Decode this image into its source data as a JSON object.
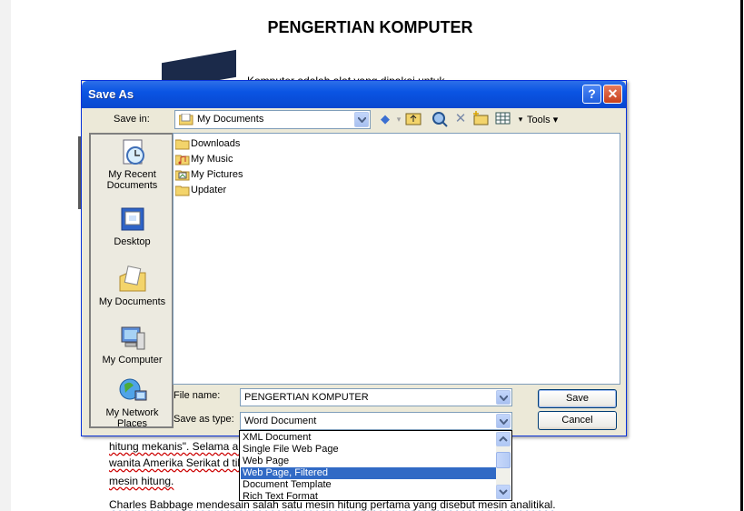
{
  "document": {
    "title": "PENGERTIAN KOMPUTER",
    "partial_line_top": "Komputer adalah alat yang dipakai untuk",
    "line1": "hitung mekanis\". Selama                                                                    ara pekerja",
    "line2": "wanita Amerika Serikat d                                                                  tileri perang dengan",
    "line3": "mesin hitung.",
    "line4": "Charles Babbage mendesain salah satu mesin hitung pertama yang disebut mesin analitikal."
  },
  "dialog": {
    "title": "Save As",
    "help_label": "?",
    "close_label": "✕",
    "save_in_label": "Save in:",
    "save_in_value": "My Documents",
    "tools_label": "Tools",
    "places": [
      {
        "label": "My Recent Documents",
        "icon": "recent-documents-icon"
      },
      {
        "label": "Desktop",
        "icon": "desktop-icon"
      },
      {
        "label": "My Documents",
        "icon": "my-documents-icon"
      },
      {
        "label": "My Computer",
        "icon": "my-computer-icon"
      },
      {
        "label": "My Network Places",
        "icon": "network-places-icon"
      }
    ],
    "files": [
      {
        "name": "Downloads",
        "icon": "folder-icon"
      },
      {
        "name": "My Music",
        "icon": "music-folder-icon"
      },
      {
        "name": "My Pictures",
        "icon": "pictures-folder-icon"
      },
      {
        "name": "Updater",
        "icon": "folder-icon"
      }
    ],
    "file_name_label": "File name:",
    "file_name_value": "PENGERTIAN KOMPUTER",
    "save_as_type_label": "Save as type:",
    "save_as_type_value": "Word Document",
    "save_button": "Save",
    "cancel_button": "Cancel",
    "type_options": [
      "XML Document",
      "Single File Web Page",
      "Web Page",
      "Web Page, Filtered",
      "Document Template",
      "Rich Text Format"
    ],
    "selected_type_option": "Web Page, Filtered"
  },
  "colors": {
    "titlebar": "#0a54e3",
    "dialog_bg": "#ece9d8",
    "selection": "#316ac5",
    "spell_underline": "#cc0000"
  }
}
